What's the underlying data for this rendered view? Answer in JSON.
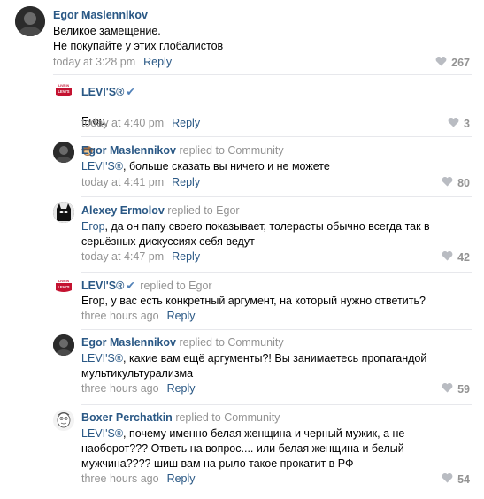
{
  "comments": [
    {
      "author": "Egor Maslennikov",
      "replied": "",
      "text": "Великое замещение.\nНе покупайте у этих глобалистов",
      "time": "today at 3:28 pm",
      "reply": "Reply",
      "likes": "267"
    },
    {
      "author": "LEVI'S®",
      "replied": "",
      "text": "Егор,",
      "time": "today at 4:40 pm",
      "reply": "Reply",
      "likes": "3"
    },
    {
      "author": "Egor Maslennikov",
      "replied": "replied to Community",
      "mention": "LEVI'S®",
      "text": ", больше сказать вы ничего и не можете",
      "time": "today at 4:41 pm",
      "reply": "Reply",
      "likes": "80"
    },
    {
      "author": "Alexey Ermolov",
      "replied": "replied to Egor",
      "mention": "Егор",
      "text": ", да он папу своего показывает, толерасты обычно всегда так в\nсерьёзных дискуссиях себя ведут",
      "time": "today at 4:47 pm",
      "reply": "Reply",
      "likes": "42"
    },
    {
      "author": "LEVI'S®",
      "replied": "replied to Egor",
      "text": "Егор, у вас есть конкретный аргумент, на который нужно ответить?",
      "time": "three hours ago",
      "reply": "Reply",
      "likes": ""
    },
    {
      "author": "Egor Maslennikov",
      "replied": "replied to Community",
      "mention": "LEVI'S®",
      "text": ", какие вам ещё аргументы?! Вы занимаетесь пропагандой\nмультикультурализма",
      "time": "three hours ago",
      "reply": "Reply",
      "likes": "59"
    },
    {
      "author": "Boxer Perchatkin",
      "replied": "replied to Community",
      "mention": "LEVI'S®",
      "text": ", почему именно белая женщина и черный мужик, а не\nнаоборот??? Ответь на вопрос.... или белая женщина и белый\nмужчина???? шиш вам на рыло такое прокатит в РФ",
      "time": "three hours ago",
      "reply": "Reply",
      "likes": "54"
    }
  ],
  "brand": {
    "logo_text_top": "LIVE IN",
    "logo_text_bottom": "LEVI'S",
    "verified_mark": "✔"
  },
  "colors": {
    "link": "#2a5885",
    "muted": "#939393",
    "divider": "#e7e8ec",
    "levis_red": "#c41230"
  }
}
